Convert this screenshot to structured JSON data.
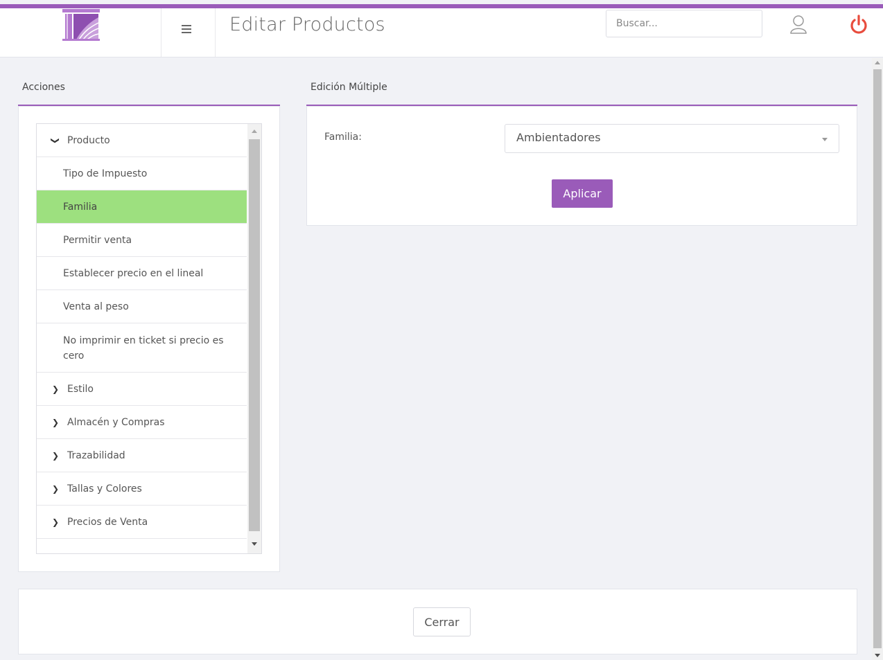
{
  "header": {
    "title": "Editar Productos",
    "search_placeholder": "Buscar...",
    "menu_icon": "hamburger-icon",
    "user_icon": "user-icon",
    "power_icon": "power-icon",
    "accent_color": "#9a5bb9",
    "power_color": "#e84c3d"
  },
  "actions_panel": {
    "title": "Acciones",
    "items": [
      {
        "label": "Producto",
        "type": "group",
        "expanded": true,
        "icon": "chevron-down-icon"
      },
      {
        "label": "Tipo de Impuesto",
        "type": "child"
      },
      {
        "label": "Familia",
        "type": "child",
        "selected": true
      },
      {
        "label": "Permitir venta",
        "type": "child"
      },
      {
        "label": "Establecer precio en el lineal",
        "type": "child"
      },
      {
        "label": "Venta al peso",
        "type": "child"
      },
      {
        "label": "No imprimir en ticket si precio es cero",
        "type": "child"
      },
      {
        "label": "Estilo",
        "type": "group",
        "expanded": false,
        "icon": "chevron-right-icon"
      },
      {
        "label": "Almacén y Compras",
        "type": "group",
        "expanded": false,
        "icon": "chevron-right-icon"
      },
      {
        "label": "Trazabilidad",
        "type": "group",
        "expanded": false,
        "icon": "chevron-right-icon"
      },
      {
        "label": "Tallas y Colores",
        "type": "group",
        "expanded": false,
        "icon": "chevron-right-icon"
      },
      {
        "label": "Precios de Venta",
        "type": "group",
        "expanded": false,
        "icon": "chevron-right-icon"
      }
    ],
    "selected_color": "#9de07f"
  },
  "edit_panel": {
    "title": "Edición Múltiple",
    "field_label": "Familia:",
    "field_value": "Ambientadores",
    "apply_label": "Aplicar"
  },
  "footer": {
    "close_label": "Cerrar"
  }
}
